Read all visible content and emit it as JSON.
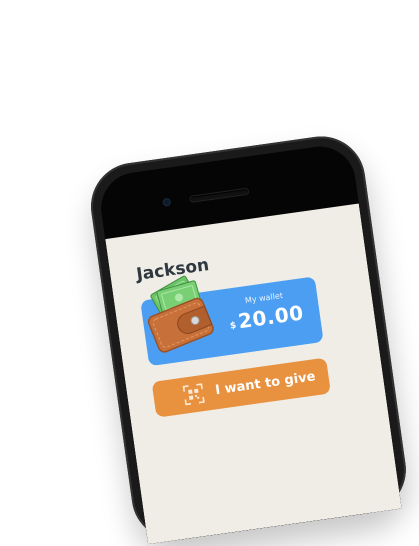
{
  "profile": {
    "name": "Jackson"
  },
  "wallet": {
    "label": "My wallet",
    "currency": "$",
    "amount": "20.00"
  },
  "actions": {
    "give_label": "I want to give"
  },
  "icons": {
    "wallet": "wallet-with-cash-icon",
    "give": "qr-code-scan-icon"
  },
  "colors": {
    "wallet_card": "#4b9ef2",
    "give_button": "#e8913f",
    "screen_background": "#efede6"
  }
}
